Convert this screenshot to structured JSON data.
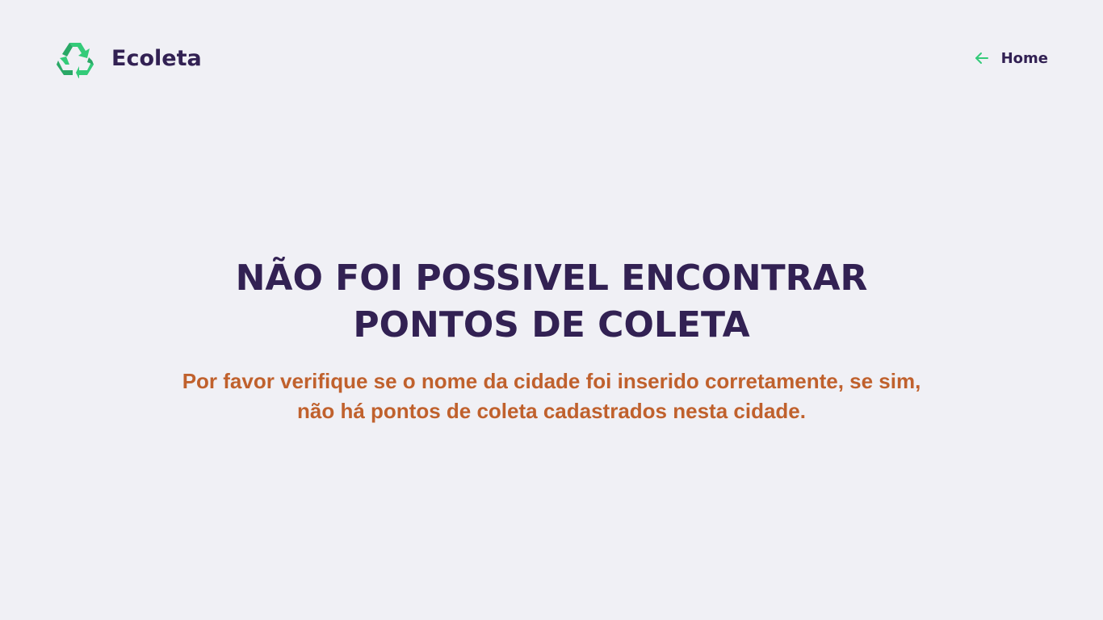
{
  "header": {
    "logo_icon": "recycle-icon",
    "brand_name": "Ecoleta",
    "home_link": {
      "icon": "arrow-left-icon",
      "label": "Home"
    }
  },
  "main": {
    "title_line_1": "NÃO FOI POSSIVEL ENCONTRAR",
    "title_line_2": "PONTOS DE COLETA",
    "message": "Por favor verifique se o nome da cidade foi inserido corretamente, se sim, não há pontos de coleta cadastrados nesta cidade."
  },
  "colors": {
    "background": "#f0f0f5",
    "title": "#322153",
    "message": "#c0612d",
    "accent": "#34cb79"
  }
}
